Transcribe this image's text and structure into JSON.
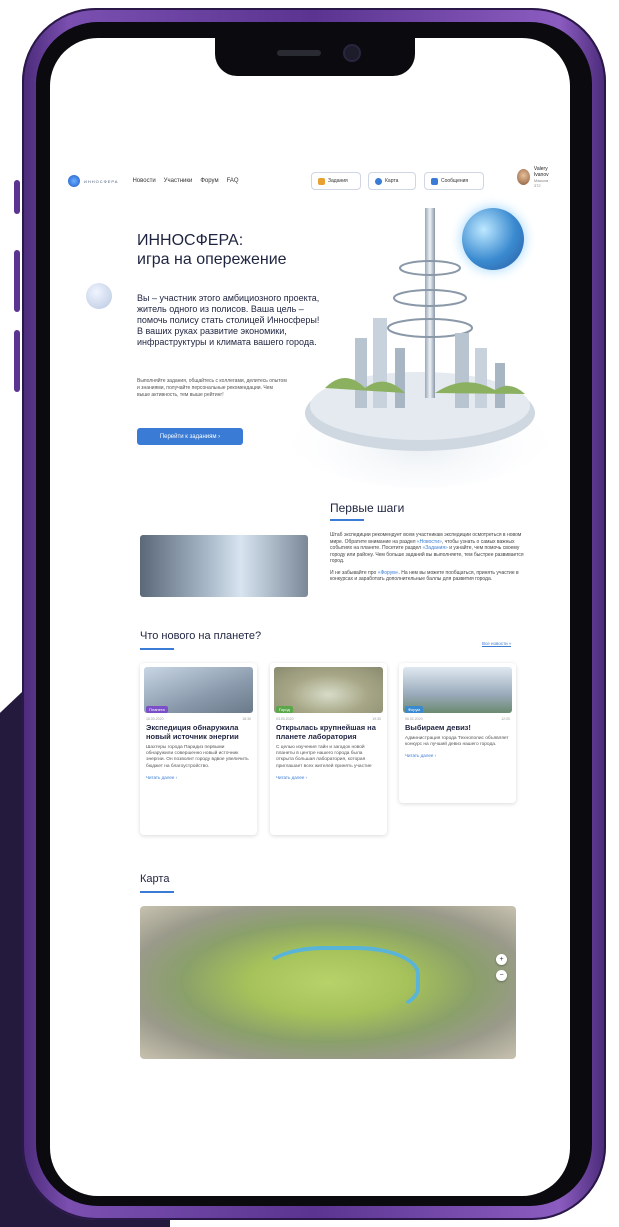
{
  "nav": {
    "logo_text": "ИННОСФЕРА",
    "links": [
      "Новости",
      "Участники",
      "Форум",
      "FAQ"
    ],
    "buttons": {
      "tasks": "Задания",
      "map": "Карта",
      "messages": "Сообщения"
    },
    "user": {
      "name": "Valery Ivanov",
      "sub": "Максим · 372"
    }
  },
  "hero": {
    "title_line1": "ИННОСФЕРА:",
    "title_line2": "игра на опережение",
    "lead": "Вы – участник этого амбициозного проекта, житель одного из полисов. Ваша цель – помочь полису стать столицей Инносферы! В ваших руках развитие экономики, инфраструктуры и климата вашего города.",
    "small": "Выполняйте задания, общайтесь с коллегами, делитесь опытом и знаниями, получайте персональные рекомендации. Чем выше активность, тем выше рейтинг!",
    "cta": "Перейти к заданиям  ›"
  },
  "first_steps": {
    "title": "Первые шаги",
    "p1_a": "Штаб экспедиции рекомендует всем участникам экспедиции осмотреться в новом мире. Обратите внимание на раздел ",
    "p1_link1": "«Новости»",
    "p1_b": ", чтобы узнать о самых важных событиях на планете. Посетите раздел ",
    "p1_link2": "«Задания»",
    "p1_c": " и узнайте, чем помочь своему городу или району. Чем больше заданий вы выполняете, тем быстрее развивается город.",
    "p2_a": "И не забывайте про ",
    "p2_link": "«Форум»",
    "p2_b": ". На нем вы можете пообщаться, принять участие в конкурсах и заработать дополнительные баллы для развития города."
  },
  "news": {
    "title": "Что нового на планете?",
    "all_link": "Все новости »",
    "cards": [
      {
        "tag": "Планета",
        "date": "16.03.2020",
        "time": "18:30",
        "title": "Экспедиция обнаружила новый источник энергии",
        "body": "Шахтеры города Парадиз первыми обнаружили совершенно новый источник энергии. Он позволит городу вдвое увеличить бюджет на благоустройство.",
        "more": "Читать далее ›"
      },
      {
        "tag": "Город",
        "date": "03.03.2020",
        "time": "19:30",
        "title": "Открылась крупнейшая на планете лаборатория",
        "body": "С целью изучения тайн и загадок новой планеты в центре нашего города была открыта большая лаборатория, которая приглашает всех жителей принять участие",
        "more": "Читать далее ›"
      },
      {
        "tag": "Форум",
        "date": "06.02.2020",
        "time": "12:00",
        "title": "Выбираем девиз!",
        "body": "Администрация города Технополис объявляет конкурс на лучший девиз нашего города.",
        "more": "Читать далее ›"
      }
    ]
  },
  "map": {
    "title": "Карта",
    "zoom_in": "+",
    "zoom_out": "−"
  },
  "colors": {
    "accent": "#3a7bd5",
    "phone_frame": "#6a3fa0",
    "dark_bg": "#241a3d",
    "tag_purple": "#7b4fc8",
    "tag_green": "#5aa84a",
    "tag_blue": "#3a8ad0"
  }
}
